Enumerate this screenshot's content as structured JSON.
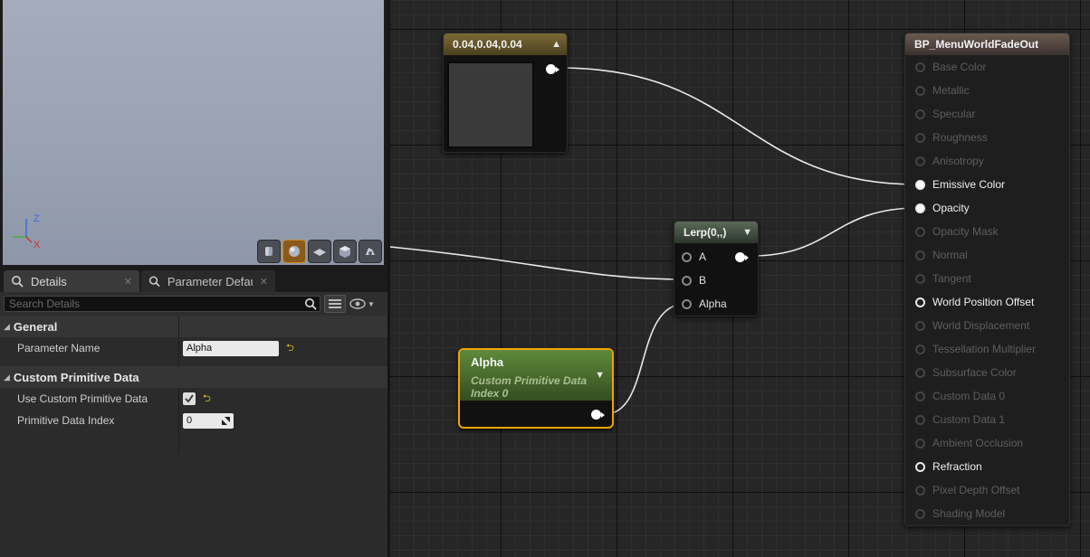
{
  "viewport": {
    "axis": {
      "z": "Z",
      "x": "X"
    },
    "buttons": [
      {
        "name": "cylinder-preview-icon",
        "active": false
      },
      {
        "name": "sphere-preview-icon",
        "active": true
      },
      {
        "name": "plane-preview-icon",
        "active": false
      },
      {
        "name": "cube-preview-icon",
        "active": false
      },
      {
        "name": "custom-mesh-preview-icon",
        "active": false
      }
    ]
  },
  "details": {
    "tabs": [
      {
        "label": "Details",
        "icon": "magnifier-icon"
      },
      {
        "label": "Parameter Defaults",
        "icon": "magnifier-icon"
      }
    ],
    "search": {
      "placeholder": "Search Details"
    },
    "categories": {
      "general": {
        "title": "General",
        "parameter_name_label": "Parameter Name",
        "parameter_name_value": "Alpha"
      },
      "custom_primitive_data": {
        "title": "Custom Primitive Data",
        "use_label": "Use Custom Primitive Data",
        "use_checked": true,
        "index_label": "Primitive Data Index",
        "index_value": "0"
      }
    }
  },
  "graph": {
    "constant_node": {
      "title": "0.04,0.04,0.04",
      "swatch_color": "#3a3a3a"
    },
    "lerp_node": {
      "title": "Lerp(0,,)",
      "pins": [
        "A",
        "B",
        "Alpha"
      ]
    },
    "alpha_node": {
      "title": "Alpha",
      "subtitle": "Custom Primitive Data Index 0"
    },
    "result_node": {
      "title": "BP_MenuWorldFadeOut",
      "inputs": [
        {
          "label": "Base Color",
          "active": false,
          "connected": false
        },
        {
          "label": "Metallic",
          "active": false,
          "connected": false
        },
        {
          "label": "Specular",
          "active": false,
          "connected": false
        },
        {
          "label": "Roughness",
          "active": false,
          "connected": false
        },
        {
          "label": "Anisotropy",
          "active": false,
          "connected": false
        },
        {
          "label": "Emissive Color",
          "active": true,
          "connected": true
        },
        {
          "label": "Opacity",
          "active": true,
          "connected": true
        },
        {
          "label": "Opacity Mask",
          "active": false,
          "connected": false
        },
        {
          "label": "Normal",
          "active": false,
          "connected": false
        },
        {
          "label": "Tangent",
          "active": false,
          "connected": false
        },
        {
          "label": "World Position Offset",
          "active": true,
          "connected": false
        },
        {
          "label": "World Displacement",
          "active": false,
          "connected": false
        },
        {
          "label": "Tessellation Multiplier",
          "active": false,
          "connected": false
        },
        {
          "label": "Subsurface Color",
          "active": false,
          "connected": false
        },
        {
          "label": "Custom Data 0",
          "active": false,
          "connected": false
        },
        {
          "label": "Custom Data 1",
          "active": false,
          "connected": false
        },
        {
          "label": "Ambient Occlusion",
          "active": false,
          "connected": false
        },
        {
          "label": "Refraction",
          "active": true,
          "connected": false
        },
        {
          "label": "Pixel Depth Offset",
          "active": false,
          "connected": false
        },
        {
          "label": "Shading Model",
          "active": false,
          "connected": false
        }
      ]
    }
  }
}
